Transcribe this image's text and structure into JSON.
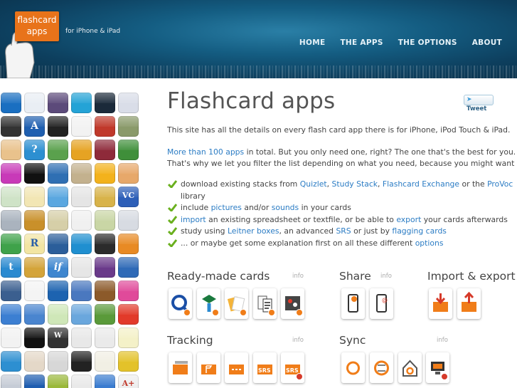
{
  "header": {
    "logo_line1": "flashcard",
    "logo_line2": "apps",
    "tagline": "for iPhone & iPad",
    "nav": [
      "HOME",
      "THE APPS",
      "THE OPTIONS",
      "ABOUT"
    ]
  },
  "main": {
    "title": "Flashcard apps",
    "tweet_label": "Tweet",
    "intro": "This site has all the details on every flash card app there is for iPhone, iPod Touch & iPad.",
    "p2_link": "More than 100 apps",
    "p2_rest": " in total. But you only need one, right? The one that's the best for you.",
    "p2_line2": "That's why we let you filter the list depending on what you need, because you might want to...",
    "bullets": {
      "b1_a": "download existing stacks from ",
      "b1_l1": "Quizlet",
      "b1_sep1": ", ",
      "b1_l2": "Study Stack",
      "b1_sep2": ", ",
      "b1_l3": "Flashcard Exchange",
      "b1_b": " or the ",
      "b1_l4": "ProVoc",
      "b1_cont": "library",
      "b2_a": "include ",
      "b2_l1": "pictures",
      "b2_b": " and/or ",
      "b2_l2": "sounds",
      "b2_c": " in your cards",
      "b3_l1": "import",
      "b3_a": " an existing spreadsheet or textfile, or be able to ",
      "b3_l2": "export",
      "b3_b": " your cards afterwards",
      "b4_a": "study using ",
      "b4_l1": "Leitner boxes",
      "b4_b": ", an advanced ",
      "b4_l2": "SRS",
      "b4_c": " or just by ",
      "b4_l3": "flagging cards",
      "b5_a": "... or maybe get some explanation first on all these different ",
      "b5_l1": "options"
    }
  },
  "sections": {
    "ready": {
      "title": "Ready-made cards",
      "info": "info"
    },
    "share": {
      "title": "Share",
      "info": "info"
    },
    "import_export": {
      "title": "Import & export"
    },
    "tracking": {
      "title": "Tracking",
      "info": "info"
    },
    "sync": {
      "title": "Sync",
      "info": "info"
    }
  },
  "icon_labels": {
    "srs1": "SRS",
    "srs2": "SRS"
  },
  "icon_wall_text": {
    "r": "R",
    "t": "t",
    "if": "if",
    "vc": "VC",
    "w": "W",
    "aplus": "A+",
    "a": "A",
    "q": "?"
  },
  "colors": {
    "accent_orange": "#e8731a",
    "link": "#2b7cc4",
    "check": "#6ab01e"
  }
}
